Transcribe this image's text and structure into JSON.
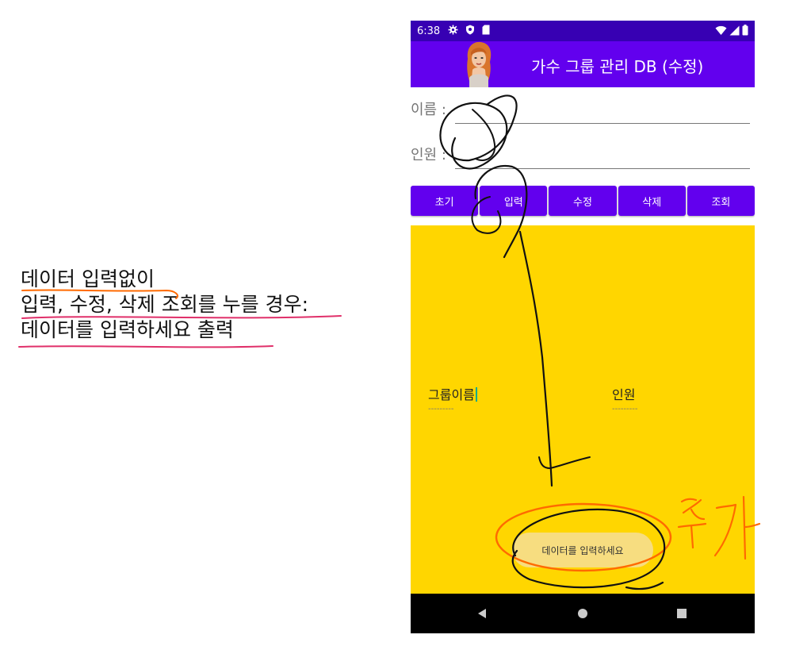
{
  "note": {
    "line1": "데이터 입력없이",
    "line2": "입력, 수정, 삭제 조회를 누를 경우:",
    "line3": "데이터를 입력하세요 출력"
  },
  "annotation": {
    "handwritten": "추가"
  },
  "statusbar": {
    "time": "6:38",
    "left_icons": [
      "gear-icon",
      "shield-icon",
      "sd-card-icon"
    ],
    "right_icons": [
      "wifi-icon",
      "signal-icon",
      "battery-icon"
    ]
  },
  "appbar": {
    "title": "가수 그룹 관리 DB (수정)",
    "icon": "avatar"
  },
  "form": {
    "name_label": "이름 :",
    "name_value": "",
    "count_label": "인원 :",
    "count_value": ""
  },
  "buttons": [
    "초기",
    "입력",
    "수정",
    "삭제",
    "조회"
  ],
  "results": {
    "group_header": "그룹이름",
    "group_dash": "---------",
    "count_header": "인원",
    "count_dash": "---------"
  },
  "toast": {
    "message": "데이터를 입력하세요"
  },
  "colors": {
    "statusbar": "#3700b3",
    "appbar": "#6200ee",
    "button": "#6200ee",
    "result_bg": "#ffd600",
    "toast_bg": "#f7dd80",
    "ink_black": "#111111",
    "ink_orange": "#ff6a00",
    "ink_pink": "#e0306a"
  },
  "navbar": {
    "icons": [
      "back-icon",
      "home-icon",
      "recents-icon"
    ]
  }
}
